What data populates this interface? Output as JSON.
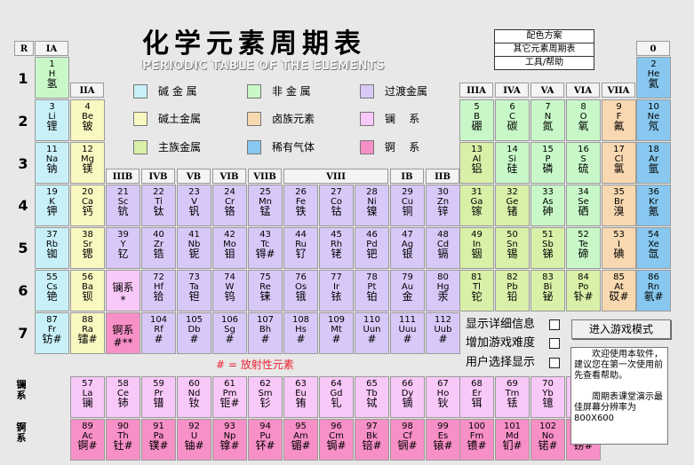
{
  "title": "化学元素周期表",
  "subtitle": "PERIODIC TABLE OF THE ELEMENTS",
  "menu": [
    "配色方案",
    "其它元素周期表",
    "工具/帮助"
  ],
  "group_headers": {
    "R": "R",
    "IA": "IA",
    "IIA": "IIA",
    "IIIB": "IIIB",
    "IVB": "IVB",
    "VB": "VB",
    "VIB": "VIB",
    "VIIB": "VIIB",
    "VIII": "VIII",
    "IB": "IB",
    "IIB": "IIB",
    "IIIA": "IIIA",
    "IVA": "IVA",
    "VA": "VA",
    "VIA": "VIA",
    "VIIA": "VIIA",
    "zero": "0"
  },
  "period_numbers": [
    "1",
    "2",
    "3",
    "4",
    "5",
    "6",
    "7"
  ],
  "legend": [
    {
      "label": "碱 金 属",
      "color": "#c8f0f8"
    },
    {
      "label": "非 金 属",
      "color": "#c8f8c8"
    },
    {
      "label": "过渡金属",
      "color": "#d8c8f8"
    },
    {
      "label": "碱土金属",
      "color": "#f8f8c0"
    },
    {
      "label": "卤族元素",
      "color": "#f8d8b0"
    },
    {
      "label": "镧    系",
      "color": "#f8c8f8"
    },
    {
      "label": "主族金属",
      "color": "#d8f0a8"
    },
    {
      "label": "稀有气体",
      "color": "#88c8f0"
    },
    {
      "label": "锕    系",
      "color": "#f890c8"
    }
  ],
  "colors": {
    "alkali": "#c8f0f8",
    "nonmetal": "#c8f8c8",
    "transition": "#d8c8f8",
    "alkaline": "#f8f8c0",
    "halogen": "#f8d8b0",
    "lanthanide": "#f8c8f8",
    "main_metal": "#d8f0a8",
    "noble": "#88c8f0",
    "actinide": "#f890c8",
    "hydrogen": "#c8f8c8"
  },
  "elements": [
    [
      "1",
      "H",
      "氢",
      "hydrogen",
      0,
      0
    ],
    [
      "2",
      "He",
      "氦",
      "noble",
      17,
      0
    ],
    [
      "3",
      "Li",
      "锂",
      "alkali",
      0,
      1
    ],
    [
      "4",
      "Be",
      "铍",
      "alkaline",
      1,
      1
    ],
    [
      "5",
      "B",
      "硼",
      "nonmetal",
      12,
      1
    ],
    [
      "6",
      "C",
      "碳",
      "nonmetal",
      13,
      1
    ],
    [
      "7",
      "N",
      "氮",
      "nonmetal",
      14,
      1
    ],
    [
      "8",
      "O",
      "氧",
      "nonmetal",
      15,
      1
    ],
    [
      "9",
      "F",
      "氟",
      "halogen",
      16,
      1
    ],
    [
      "10",
      "Ne",
      "氖",
      "noble",
      17,
      1
    ],
    [
      "11",
      "Na",
      "钠",
      "alkali",
      0,
      2
    ],
    [
      "12",
      "Mg",
      "镁",
      "alkaline",
      1,
      2
    ],
    [
      "13",
      "Al",
      "铝",
      "main_metal",
      12,
      2
    ],
    [
      "14",
      "Si",
      "硅",
      "nonmetal",
      13,
      2
    ],
    [
      "15",
      "P",
      "磷",
      "nonmetal",
      14,
      2
    ],
    [
      "16",
      "S",
      "硫",
      "nonmetal",
      15,
      2
    ],
    [
      "17",
      "Cl",
      "氯",
      "halogen",
      16,
      2
    ],
    [
      "18",
      "Ar",
      "氩",
      "noble",
      17,
      2
    ],
    [
      "19",
      "K",
      "钾",
      "alkali",
      0,
      3
    ],
    [
      "20",
      "Ca",
      "钙",
      "alkaline",
      1,
      3
    ],
    [
      "21",
      "Sc",
      "钪",
      "transition",
      2,
      3
    ],
    [
      "22",
      "Ti",
      "钛",
      "transition",
      3,
      3
    ],
    [
      "23",
      "V",
      "钒",
      "transition",
      4,
      3
    ],
    [
      "24",
      "Cr",
      "铬",
      "transition",
      5,
      3
    ],
    [
      "25",
      "Mn",
      "锰",
      "transition",
      6,
      3
    ],
    [
      "26",
      "Fe",
      "铁",
      "transition",
      7,
      3
    ],
    [
      "27",
      "Co",
      "钴",
      "transition",
      8,
      3
    ],
    [
      "28",
      "Ni",
      "镍",
      "transition",
      9,
      3
    ],
    [
      "29",
      "Cu",
      "铜",
      "transition",
      10,
      3
    ],
    [
      "30",
      "Zn",
      "锌",
      "transition",
      11,
      3
    ],
    [
      "31",
      "Ga",
      "镓",
      "main_metal",
      12,
      3
    ],
    [
      "32",
      "Ge",
      "锗",
      "main_metal",
      13,
      3
    ],
    [
      "33",
      "As",
      "砷",
      "nonmetal",
      14,
      3
    ],
    [
      "34",
      "Se",
      "硒",
      "nonmetal",
      15,
      3
    ],
    [
      "35",
      "Br",
      "溴",
      "halogen",
      16,
      3
    ],
    [
      "36",
      "Kr",
      "氪",
      "noble",
      17,
      3
    ],
    [
      "37",
      "Rb",
      "铷",
      "alkali",
      0,
      4
    ],
    [
      "38",
      "Sr",
      "锶",
      "alkaline",
      1,
      4
    ],
    [
      "39",
      "Y",
      "钇",
      "transition",
      2,
      4
    ],
    [
      "40",
      "Zr",
      "锆",
      "transition",
      3,
      4
    ],
    [
      "41",
      "Nb",
      "铌",
      "transition",
      4,
      4
    ],
    [
      "42",
      "Mo",
      "钼",
      "transition",
      5,
      4
    ],
    [
      "43",
      "Tc",
      "锝#",
      "transition",
      6,
      4
    ],
    [
      "44",
      "Ru",
      "钌",
      "transition",
      7,
      4
    ],
    [
      "45",
      "Rh",
      "铑",
      "transition",
      8,
      4
    ],
    [
      "46",
      "Pd",
      "钯",
      "transition",
      9,
      4
    ],
    [
      "47",
      "Ag",
      "银",
      "transition",
      10,
      4
    ],
    [
      "48",
      "Cd",
      "镉",
      "transition",
      11,
      4
    ],
    [
      "49",
      "In",
      "铟",
      "main_metal",
      12,
      4
    ],
    [
      "50",
      "Sn",
      "锡",
      "main_metal",
      13,
      4
    ],
    [
      "51",
      "Sb",
      "锑",
      "main_metal",
      14,
      4
    ],
    [
      "52",
      "Te",
      "碲",
      "nonmetal",
      15,
      4
    ],
    [
      "53",
      "I",
      "碘",
      "halogen",
      16,
      4
    ],
    [
      "54",
      "Xe",
      "氙",
      "noble",
      17,
      4
    ],
    [
      "55",
      "Cs",
      "铯",
      "alkali",
      0,
      5
    ],
    [
      "56",
      "Ba",
      "钡",
      "alkaline",
      1,
      5
    ],
    [
      "",
      "",
      "镧系\n*",
      "lanthanide",
      2,
      5
    ],
    [
      "72",
      "Hf",
      "铪",
      "transition",
      3,
      5
    ],
    [
      "73",
      "Ta",
      "钽",
      "transition",
      4,
      5
    ],
    [
      "74",
      "W",
      "钨",
      "transition",
      5,
      5
    ],
    [
      "75",
      "Re",
      "铼",
      "transition",
      6,
      5
    ],
    [
      "76",
      "Os",
      "锇",
      "transition",
      7,
      5
    ],
    [
      "77",
      "Ir",
      "铱",
      "transition",
      8,
      5
    ],
    [
      "78",
      "Pt",
      "铂",
      "transition",
      9,
      5
    ],
    [
      "79",
      "Au",
      "金",
      "transition",
      10,
      5
    ],
    [
      "80",
      "Hg",
      "汞",
      "transition",
      11,
      5
    ],
    [
      "81",
      "Tl",
      "铊",
      "main_metal",
      12,
      5
    ],
    [
      "82",
      "Pb",
      "铅",
      "main_metal",
      13,
      5
    ],
    [
      "83",
      "Bi",
      "铋",
      "main_metal",
      14,
      5
    ],
    [
      "84",
      "Po",
      "钋#",
      "main_metal",
      15,
      5
    ],
    [
      "85",
      "At",
      "砹#",
      "halogen",
      16,
      5
    ],
    [
      "86",
      "Rn",
      "氡#",
      "noble",
      17,
      5
    ],
    [
      "87",
      "Fr",
      "钫#",
      "alkali",
      0,
      6
    ],
    [
      "88",
      "Ra",
      "镭#",
      "alkaline",
      1,
      6
    ],
    [
      "",
      "",
      "锕系\n#**",
      "actinide",
      2,
      6
    ],
    [
      "104",
      "Rf",
      "#",
      "transition",
      3,
      6
    ],
    [
      "105",
      "Db",
      "#",
      "transition",
      4,
      6
    ],
    [
      "106",
      "Sg",
      "#",
      "transition",
      5,
      6
    ],
    [
      "107",
      "Bh",
      "#",
      "transition",
      6,
      6
    ],
    [
      "108",
      "Hs",
      "#",
      "transition",
      7,
      6
    ],
    [
      "109",
      "Mt",
      "#",
      "transition",
      8,
      6
    ],
    [
      "110",
      "Uun",
      "#",
      "transition",
      9,
      6
    ],
    [
      "111",
      "Uuu",
      "#",
      "transition",
      10,
      6
    ],
    [
      "112",
      "Uub",
      "#",
      "transition",
      11,
      6
    ]
  ],
  "lanthanides": [
    [
      "57",
      "La",
      "镧"
    ],
    [
      "58",
      "Ce",
      "铈"
    ],
    [
      "59",
      "Pr",
      "镨"
    ],
    [
      "60",
      "Nd",
      "钕"
    ],
    [
      "61",
      "Pm",
      "钷#"
    ],
    [
      "62",
      "Sm",
      "钐"
    ],
    [
      "63",
      "Eu",
      "铕"
    ],
    [
      "64",
      "Gd",
      "钆"
    ],
    [
      "65",
      "Tb",
      "铽"
    ],
    [
      "66",
      "Dy",
      "镝"
    ],
    [
      "67",
      "Ho",
      "钬"
    ],
    [
      "68",
      "Er",
      "铒"
    ],
    [
      "69",
      "Tm",
      "铥"
    ],
    [
      "70",
      "Yb",
      "镱"
    ],
    [
      "71",
      "Lu",
      "镥"
    ]
  ],
  "actinides": [
    [
      "89",
      "Ac",
      "锕#"
    ],
    [
      "90",
      "Th",
      "钍#"
    ],
    [
      "91",
      "Pa",
      "镤#"
    ],
    [
      "92",
      "U",
      "铀#"
    ],
    [
      "93",
      "Np",
      "镎#"
    ],
    [
      "94",
      "Pu",
      "钚#"
    ],
    [
      "95",
      "Am",
      "镅#"
    ],
    [
      "96",
      "Cm",
      "锔#"
    ],
    [
      "97",
      "Bk",
      "锫#"
    ],
    [
      "98",
      "Cf",
      "锎#"
    ],
    [
      "99",
      "Es",
      "锿#"
    ],
    [
      "100",
      "Fm",
      "镄#"
    ],
    [
      "101",
      "Md",
      "钔#"
    ],
    [
      "102",
      "No",
      "锘#"
    ],
    [
      "103",
      "Lr",
      "铹#"
    ]
  ],
  "series_labels": {
    "lanthanide": "镧\n系",
    "actinide": "锕\n系"
  },
  "radioactive_note": "# = 放射性元素",
  "options": [
    "显示详细信息",
    "增加游戏难度",
    "用户选择显示"
  ],
  "game_button": "进入游戏模式",
  "help_text_1": "欢迎使用本软件，建议您在第一次使用前先查看帮助。",
  "help_text_2": "周期表课堂演示最佳屏幕分辨率为800X600"
}
